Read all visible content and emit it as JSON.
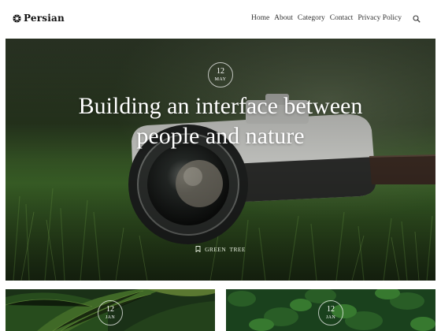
{
  "brand": {
    "name": "Persian",
    "logo_icon": "sunflower-icon"
  },
  "nav": {
    "items": [
      "Home",
      "About",
      "Category",
      "Contact",
      "Privacy Policy"
    ],
    "search_icon": "search-icon"
  },
  "hero": {
    "date": {
      "day": "12",
      "month": "MAY"
    },
    "title_line1": "Building an interface between",
    "title_line2": "people and nature",
    "tag": "GREEN  TREE",
    "tag_icon": "bookmark-icon"
  },
  "cards": [
    {
      "date": {
        "day": "12",
        "month": "JAN"
      }
    },
    {
      "date": {
        "day": "12",
        "month": "JAN"
      }
    }
  ],
  "colors": {
    "accent_text": "#ffffff",
    "hero_green": "#2f4a22"
  }
}
